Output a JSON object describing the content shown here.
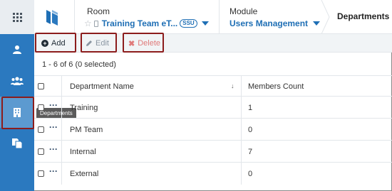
{
  "header": {
    "room_label": "Room",
    "room_name": "Training Team eT...",
    "room_badge": "SSU",
    "module_label": "Module",
    "module_name": "Users Management",
    "current_page": "Departments"
  },
  "sidebar": {
    "items": [
      {
        "icon": "user-icon"
      },
      {
        "icon": "users-group-icon"
      },
      {
        "icon": "building-icon",
        "active": true,
        "tooltip": "Departments"
      },
      {
        "icon": "documents-icon"
      }
    ]
  },
  "toolbar": {
    "add_label": "Add",
    "edit_label": "Edit",
    "delete_label": "Delete"
  },
  "list": {
    "count_text": "1 - 6 of 6 (0 selected)",
    "columns": [
      "Department Name",
      "Members Count"
    ],
    "sort_indicator": "↓",
    "rows": [
      {
        "name": "Training",
        "count": "1"
      },
      {
        "name": "PM Team",
        "count": "0"
      },
      {
        "name": "Internal",
        "count": "7"
      },
      {
        "name": "External",
        "count": "0"
      }
    ]
  },
  "colors": {
    "sidebar": "#2b79bf",
    "link": "#1f6fb5",
    "highlight": "#8c1c1c",
    "delete": "#e07a7a"
  }
}
